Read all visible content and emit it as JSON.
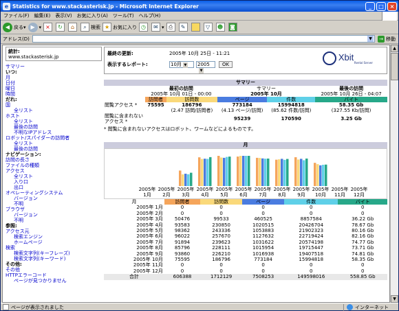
{
  "window": {
    "title": "Statistics for www.stackasterisk.jp - Microsoft Internet Explorer"
  },
  "menu": [
    "ファイル(F)",
    "編集(E)",
    "表示(V)",
    "お気に入り(A)",
    "ツール(T)",
    "ヘルプ(H)"
  ],
  "toolbar": {
    "back": "戻る",
    "search": "検索",
    "favorites": "お気に入り"
  },
  "address": {
    "label": "アドレス(D)",
    "go": "移動"
  },
  "nav": {
    "stats_label": "統計:",
    "site": "www.stackasterisk.jp",
    "items": [
      {
        "t": "サマリー",
        "c": "a"
      },
      {
        "t": "いつ:",
        "c": "sec"
      },
      {
        "t": "月",
        "c": "a"
      },
      {
        "t": "日付",
        "c": "a"
      },
      {
        "t": "曜日",
        "c": "a"
      },
      {
        "t": "時間",
        "c": "a"
      },
      {
        "t": "だれ:",
        "c": "sec"
      },
      {
        "t": "国",
        "c": "a"
      },
      {
        "t": "全リスト",
        "c": "sub"
      },
      {
        "t": "ホスト",
        "c": "a"
      },
      {
        "t": "全リスト",
        "c": "sub"
      },
      {
        "t": "最後の訪問",
        "c": "sub"
      },
      {
        "t": "不明なIPアドレス",
        "c": "sub"
      },
      {
        "t": "ロボット/スパイダーの訪問者",
        "c": "a"
      },
      {
        "t": "全リスト",
        "c": "sub"
      },
      {
        "t": "最後の訪問",
        "c": "sub"
      },
      {
        "t": "ナビゲーション:",
        "c": "sec"
      },
      {
        "t": "訪問の長さ",
        "c": "a"
      },
      {
        "t": "ファイルの種類",
        "c": "a"
      },
      {
        "t": "アクセス",
        "c": "a"
      },
      {
        "t": "全リスト",
        "c": "sub"
      },
      {
        "t": "入り口",
        "c": "sub"
      },
      {
        "t": "出口",
        "c": "sub"
      },
      {
        "t": "オペレーティングシステム",
        "c": "a"
      },
      {
        "t": "バージョン",
        "c": "sub"
      },
      {
        "t": "不明",
        "c": "sub"
      },
      {
        "t": "ブラウザ",
        "c": "a"
      },
      {
        "t": "バージョン",
        "c": "sub"
      },
      {
        "t": "不明",
        "c": "sub"
      },
      {
        "t": "参照:",
        "c": "sec"
      },
      {
        "t": "アクセス元",
        "c": "a"
      },
      {
        "t": "検索エンジン",
        "c": "sub"
      },
      {
        "t": "ホームページ",
        "c": "sub"
      },
      {
        "t": "検索",
        "c": "a"
      },
      {
        "t": "検索文字列(キーフレーズ)",
        "c": "sub"
      },
      {
        "t": "検索文字列(キーワード)",
        "c": "sub"
      },
      {
        "t": "その他:",
        "c": "sec"
      },
      {
        "t": "その他",
        "c": "a"
      },
      {
        "t": "HTTPエラーコード",
        "c": "a"
      },
      {
        "t": "ページが見つかりません",
        "c": "sub"
      }
    ]
  },
  "top": {
    "last_update_label": "最終の更新:",
    "last_update": "2005年 10月 25日 - 11:21",
    "report_label": "表示するレポート:",
    "month": "10月",
    "year": "2005",
    "ok": "OK",
    "logo": "Xbit",
    "logo_sub": "Rental Server"
  },
  "summary": {
    "title": "サマリー",
    "first_label": "最初の訪問",
    "first_date": "2005年 10月 01日 - 00:00",
    "center": "サマリー",
    "center_period": "2005年 10月",
    "last_label": "最後の訪問",
    "last_date": "2005年 10月 26日 - 04:07",
    "cols": [
      "訪問者",
      "訪問数",
      "ページ",
      "件数",
      "バイト"
    ],
    "row1_label": "閲覧アクセス *",
    "row1": [
      "75595",
      "186796",
      "773184",
      "15994818",
      "58.35 Gb"
    ],
    "row1_sub": [
      "",
      "(2.47 訪問/訪問者)",
      "(4.13 ページ/訪問)",
      "(85.62 件数/訪問)",
      "(327.55 Kb/訪問)"
    ],
    "row2_label": "閲覧に含まれないアクセス *",
    "row2": [
      "",
      "",
      "95239",
      "170590",
      "3.25 Gb"
    ],
    "note": "* 閲覧に含まれないアクセスはロボット、ワームなどによるものです。"
  },
  "monthly": {
    "title": "月",
    "axis": [
      [
        "2005年",
        "1月"
      ],
      [
        "2005年",
        "2月"
      ],
      [
        "2005年",
        "3月"
      ],
      [
        "2005年",
        "4月"
      ],
      [
        "2005年",
        "5月"
      ],
      [
        "2005年",
        "6月"
      ],
      [
        "2005年",
        "7月"
      ],
      [
        "2005年",
        "8月"
      ],
      [
        "2005年",
        "9月"
      ],
      [
        "2005年",
        "10月"
      ],
      [
        "2005年",
        "11月"
      ],
      [
        "2005年",
        "12月"
      ]
    ],
    "headers": [
      "月",
      "訪問者",
      "訪問数",
      "ページ",
      "件数",
      "バイト"
    ],
    "rows": [
      [
        "2005年 1月",
        "0",
        "0",
        "0",
        "0",
        "0"
      ],
      [
        "2005年 2月",
        "0",
        "0",
        "0",
        "0",
        "0"
      ],
      [
        "2005年 3月",
        "50476",
        "99533",
        "460525",
        "8857584",
        "36.22 Gb"
      ],
      [
        "2005年 4月",
        "93583",
        "230850",
        "1020515",
        "20426704",
        "78.67 Gb"
      ],
      [
        "2005年 5月",
        "98362",
        "243336",
        "1053883",
        "21902323",
        "80.16 Gb"
      ],
      [
        "2005年 6月",
        "96022",
        "257670",
        "1127632",
        "22719424",
        "82.16 Gb"
      ],
      [
        "2005年 7月",
        "91894",
        "239623",
        "1031622",
        "20574198",
        "74.77 Gb"
      ],
      [
        "2005年 8月",
        "85796",
        "228111",
        "1015954",
        "19715447",
        "73.71 Gb"
      ],
      [
        "2005年 9月",
        "93860",
        "226210",
        "1016938",
        "19407518",
        "74.81 Gb"
      ],
      [
        "2005年 10月",
        "75595",
        "186796",
        "773184",
        "15994818",
        "58.35 Gb"
      ],
      [
        "2005年 11月",
        "0",
        "0",
        "0",
        "0",
        "0"
      ],
      [
        "2005年 12月",
        "0",
        "0",
        "0",
        "0",
        "0"
      ]
    ],
    "total": [
      "合計",
      "606388",
      "1712129",
      "7508253",
      "149598016",
      "558.85 Gb"
    ]
  },
  "chart_data": {
    "type": "bar",
    "categories": [
      "1月",
      "2月",
      "3月",
      "4月",
      "5月",
      "6月",
      "7月",
      "8月",
      "9月",
      "10月",
      "11月",
      "12月"
    ],
    "series": [
      {
        "name": "訪問者",
        "values": [
          0,
          0,
          50476,
          93583,
          98362,
          96022,
          91894,
          85796,
          93860,
          75595,
          0,
          0
        ]
      },
      {
        "name": "訪問数",
        "values": [
          0,
          0,
          99533,
          230850,
          243336,
          257670,
          239623,
          228111,
          226210,
          186796,
          0,
          0
        ]
      },
      {
        "name": "ページ",
        "values": [
          0,
          0,
          460525,
          1020515,
          1053883,
          1127632,
          1031622,
          1015954,
          1016938,
          773184,
          0,
          0
        ]
      },
      {
        "name": "件数",
        "values": [
          0,
          0,
          8857584,
          20426704,
          21902323,
          22719424,
          20574198,
          19715447,
          19407518,
          15994818,
          0,
          0
        ]
      },
      {
        "name": "バイト",
        "values": [
          0,
          0,
          36.22,
          78.67,
          80.16,
          82.16,
          74.77,
          73.71,
          74.81,
          58.35,
          0,
          0
        ]
      }
    ],
    "colors": [
      "#f5a55b",
      "#fad97a",
      "#4a7ce0",
      "#5fd0e8",
      "#27a889"
    ]
  },
  "status": {
    "message": "ページが表示されました",
    "zone": "インターネット"
  }
}
